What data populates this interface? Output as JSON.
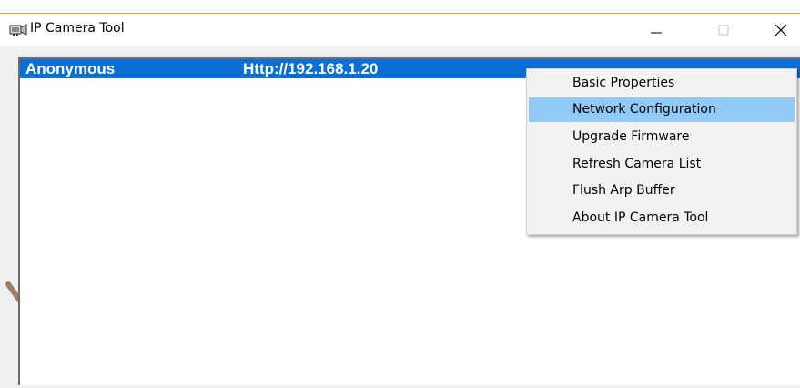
{
  "window": {
    "title": "IP Camera Tool",
    "accent_color": "#e8a33f"
  },
  "window_controls": {
    "minimize_icon": "minimize-icon",
    "maximize_icon": "maximize-icon",
    "close_icon": "close-icon"
  },
  "camera_list": {
    "selection_color": "#0a6fd4",
    "rows": [
      {
        "name": "Anonymous",
        "url": "Http://192.168.1.20"
      }
    ]
  },
  "context_menu": {
    "highlight_color": "#91c9f7",
    "items": [
      {
        "label": "Basic Properties"
      },
      {
        "label": "Network Configuration",
        "highlighted": true
      },
      {
        "label": "Upgrade Firmware"
      },
      {
        "label": "Refresh Camera List"
      },
      {
        "label": "Flush Arp Buffer"
      },
      {
        "label": "About IP Camera Tool"
      }
    ]
  }
}
